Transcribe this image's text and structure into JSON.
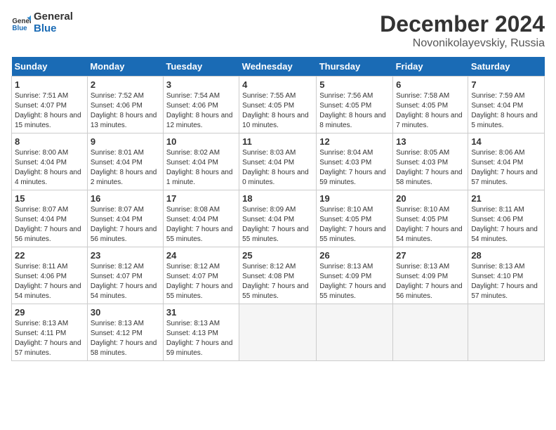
{
  "logo": {
    "line1": "General",
    "line2": "Blue"
  },
  "title": "December 2024",
  "subtitle": "Novonikolayevskiy, Russia",
  "days_of_week": [
    "Sunday",
    "Monday",
    "Tuesday",
    "Wednesday",
    "Thursday",
    "Friday",
    "Saturday"
  ],
  "weeks": [
    [
      {
        "day": "1",
        "sunrise": "7:51 AM",
        "sunset": "4:07 PM",
        "daylight": "8 hours and 15 minutes."
      },
      {
        "day": "2",
        "sunrise": "7:52 AM",
        "sunset": "4:06 PM",
        "daylight": "8 hours and 13 minutes."
      },
      {
        "day": "3",
        "sunrise": "7:54 AM",
        "sunset": "4:06 PM",
        "daylight": "8 hours and 12 minutes."
      },
      {
        "day": "4",
        "sunrise": "7:55 AM",
        "sunset": "4:05 PM",
        "daylight": "8 hours and 10 minutes."
      },
      {
        "day": "5",
        "sunrise": "7:56 AM",
        "sunset": "4:05 PM",
        "daylight": "8 hours and 8 minutes."
      },
      {
        "day": "6",
        "sunrise": "7:58 AM",
        "sunset": "4:05 PM",
        "daylight": "8 hours and 7 minutes."
      },
      {
        "day": "7",
        "sunrise": "7:59 AM",
        "sunset": "4:04 PM",
        "daylight": "8 hours and 5 minutes."
      }
    ],
    [
      {
        "day": "8",
        "sunrise": "8:00 AM",
        "sunset": "4:04 PM",
        "daylight": "8 hours and 4 minutes."
      },
      {
        "day": "9",
        "sunrise": "8:01 AM",
        "sunset": "4:04 PM",
        "daylight": "8 hours and 2 minutes."
      },
      {
        "day": "10",
        "sunrise": "8:02 AM",
        "sunset": "4:04 PM",
        "daylight": "8 hours and 1 minute."
      },
      {
        "day": "11",
        "sunrise": "8:03 AM",
        "sunset": "4:04 PM",
        "daylight": "8 hours and 0 minutes."
      },
      {
        "day": "12",
        "sunrise": "8:04 AM",
        "sunset": "4:03 PM",
        "daylight": "7 hours and 59 minutes."
      },
      {
        "day": "13",
        "sunrise": "8:05 AM",
        "sunset": "4:03 PM",
        "daylight": "7 hours and 58 minutes."
      },
      {
        "day": "14",
        "sunrise": "8:06 AM",
        "sunset": "4:04 PM",
        "daylight": "7 hours and 57 minutes."
      }
    ],
    [
      {
        "day": "15",
        "sunrise": "8:07 AM",
        "sunset": "4:04 PM",
        "daylight": "7 hours and 56 minutes."
      },
      {
        "day": "16",
        "sunrise": "8:07 AM",
        "sunset": "4:04 PM",
        "daylight": "7 hours and 56 minutes."
      },
      {
        "day": "17",
        "sunrise": "8:08 AM",
        "sunset": "4:04 PM",
        "daylight": "7 hours and 55 minutes."
      },
      {
        "day": "18",
        "sunrise": "8:09 AM",
        "sunset": "4:04 PM",
        "daylight": "7 hours and 55 minutes."
      },
      {
        "day": "19",
        "sunrise": "8:10 AM",
        "sunset": "4:05 PM",
        "daylight": "7 hours and 55 minutes."
      },
      {
        "day": "20",
        "sunrise": "8:10 AM",
        "sunset": "4:05 PM",
        "daylight": "7 hours and 54 minutes."
      },
      {
        "day": "21",
        "sunrise": "8:11 AM",
        "sunset": "4:06 PM",
        "daylight": "7 hours and 54 minutes."
      }
    ],
    [
      {
        "day": "22",
        "sunrise": "8:11 AM",
        "sunset": "4:06 PM",
        "daylight": "7 hours and 54 minutes."
      },
      {
        "day": "23",
        "sunrise": "8:12 AM",
        "sunset": "4:07 PM",
        "daylight": "7 hours and 54 minutes."
      },
      {
        "day": "24",
        "sunrise": "8:12 AM",
        "sunset": "4:07 PM",
        "daylight": "7 hours and 55 minutes."
      },
      {
        "day": "25",
        "sunrise": "8:12 AM",
        "sunset": "4:08 PM",
        "daylight": "7 hours and 55 minutes."
      },
      {
        "day": "26",
        "sunrise": "8:13 AM",
        "sunset": "4:09 PM",
        "daylight": "7 hours and 55 minutes."
      },
      {
        "day": "27",
        "sunrise": "8:13 AM",
        "sunset": "4:09 PM",
        "daylight": "7 hours and 56 minutes."
      },
      {
        "day": "28",
        "sunrise": "8:13 AM",
        "sunset": "4:10 PM",
        "daylight": "7 hours and 57 minutes."
      }
    ],
    [
      {
        "day": "29",
        "sunrise": "8:13 AM",
        "sunset": "4:11 PM",
        "daylight": "7 hours and 57 minutes."
      },
      {
        "day": "30",
        "sunrise": "8:13 AM",
        "sunset": "4:12 PM",
        "daylight": "7 hours and 58 minutes."
      },
      {
        "day": "31",
        "sunrise": "8:13 AM",
        "sunset": "4:13 PM",
        "daylight": "7 hours and 59 minutes."
      },
      null,
      null,
      null,
      null
    ]
  ]
}
